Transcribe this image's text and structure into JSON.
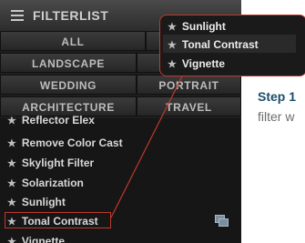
{
  "panel": {
    "title": "FILTERLIST",
    "categories": [
      "ALL",
      "F",
      "LANDSCAPE",
      "WEDDING",
      "PORTRAIT",
      "ARCHITECTURE",
      "TRAVEL"
    ],
    "filters": [
      "Reflector Elex",
      "Remove Color Cast",
      "Skylight Filter",
      "Solarization",
      "Sunlight",
      "Tonal Contrast",
      "Vignette"
    ],
    "selected_filter": "Tonal Contrast"
  },
  "popup": {
    "items": [
      "Sunlight",
      "Tonal Contrast",
      "Vignette"
    ]
  },
  "caption": {
    "step": "Step 1",
    "text": "filter w"
  },
  "colors": {
    "highlight": "#c0392b",
    "step_label": "#1b4e6b"
  },
  "icons": {
    "menu": "hamburger-icon",
    "star": "star-icon",
    "stack": "layers-icon"
  }
}
